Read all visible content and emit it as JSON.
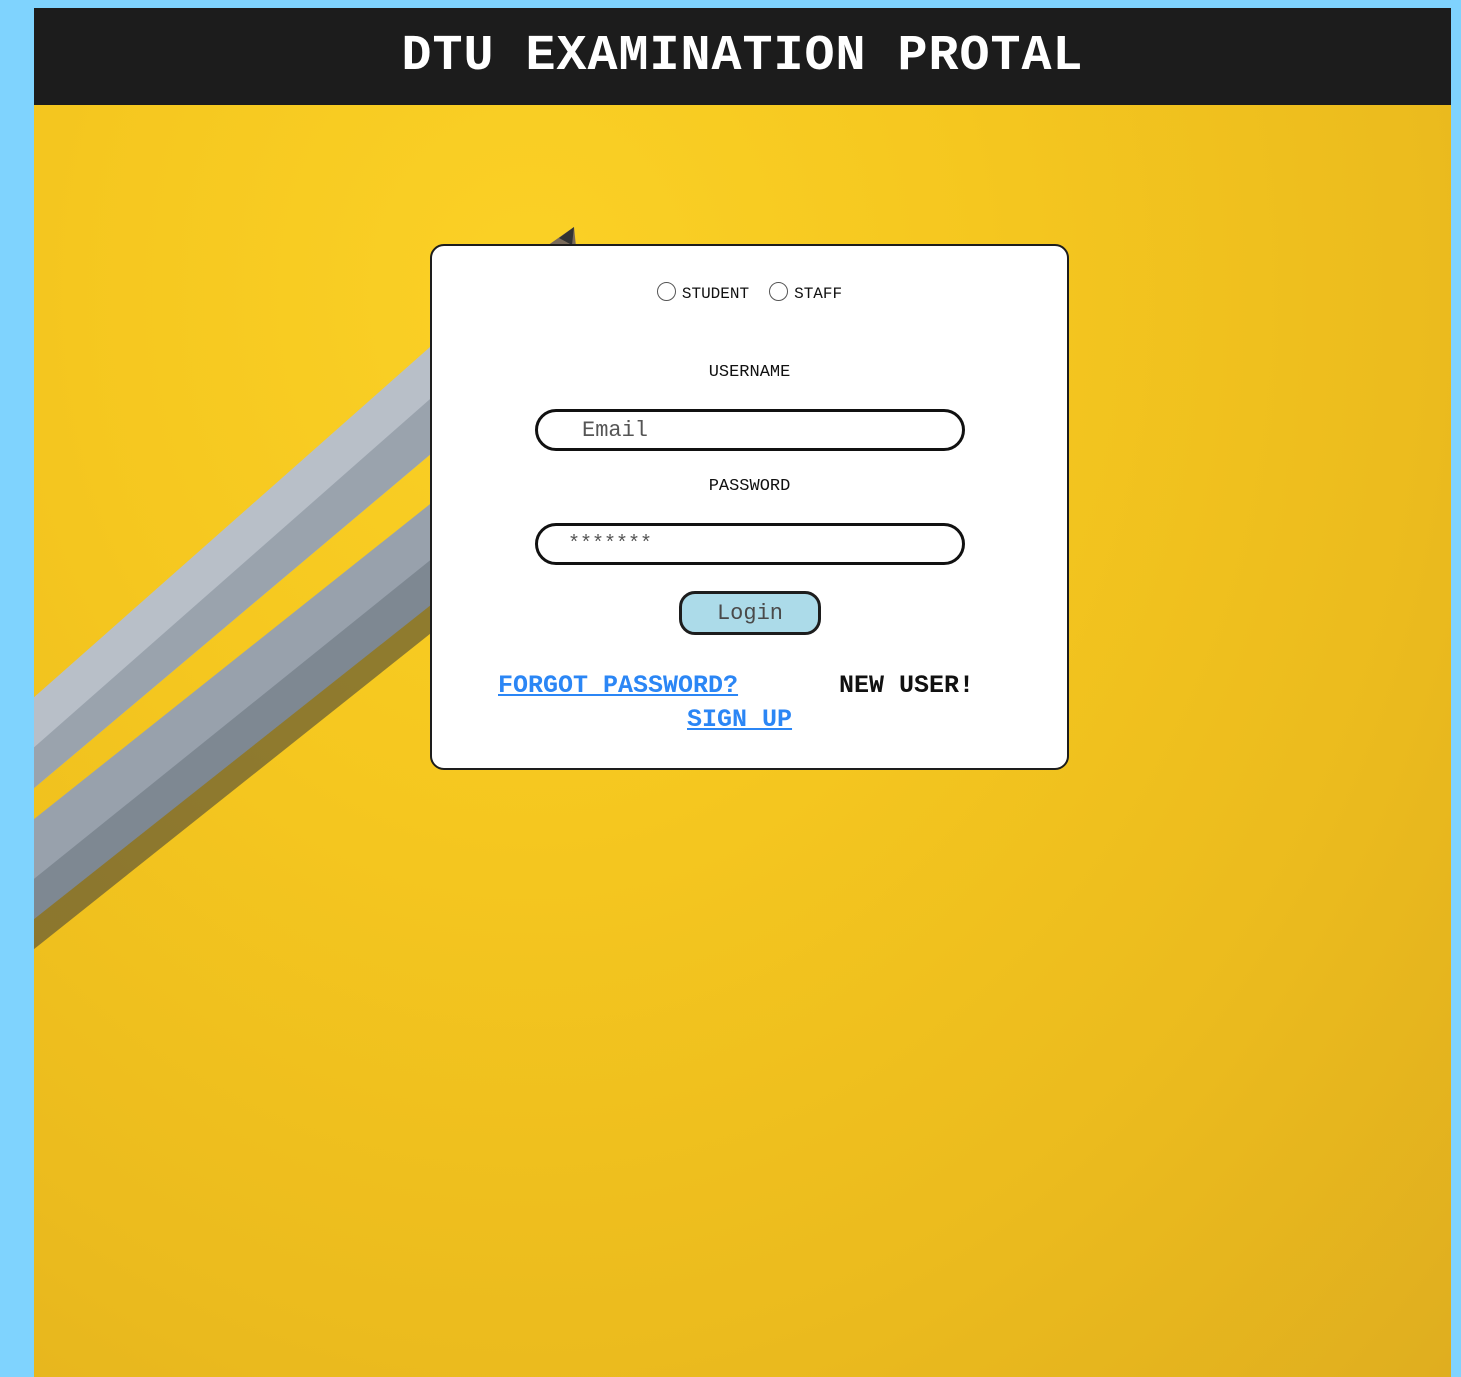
{
  "header": {
    "title": "DTU EXAMINATION PROTAL"
  },
  "login": {
    "role_options": [
      "STUDENT",
      "STAFF"
    ],
    "username_label": "USERNAME",
    "username_placeholder": "Email",
    "password_label": "PASSWORD",
    "password_value": "*******",
    "login_button": "Login",
    "forgot_password": "FORGOT PASSWORD?",
    "new_user": "NEW USER!",
    "sign_up": "SIGN UP"
  },
  "colors": {
    "header_bg": "#1c1c1c",
    "page_bg": "#7fd3fe",
    "background_yellow": "#f5c71f",
    "button_bg": "#acdbe9",
    "link": "#2b86f5"
  }
}
